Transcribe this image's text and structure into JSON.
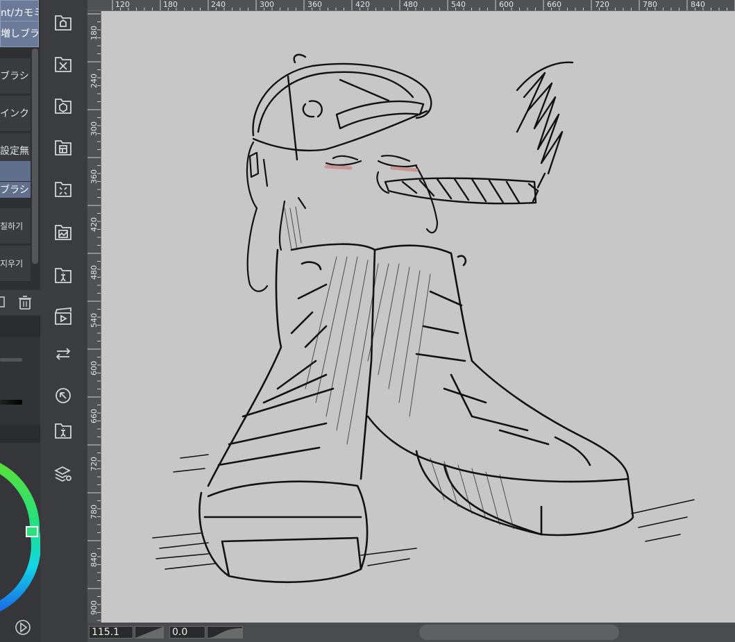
{
  "brush_panel": {
    "tabs": [
      {
        "label": "nt/カモミ"
      },
      {
        "label": "増しブラ"
      }
    ],
    "items": [
      {
        "label": "ブラシ",
        "selected": false
      },
      {
        "label": "インク",
        "selected": false
      },
      {
        "label": "設定無",
        "selected": false
      },
      {
        "label": "",
        "selected": true
      },
      {
        "label": "ブラシ",
        "selected": true
      },
      {
        "label": "칠하기",
        "selected": false
      },
      {
        "label": "지우기",
        "selected": false
      }
    ],
    "toolbar_icons": [
      "duplicate-icon",
      "trash-icon"
    ],
    "bottom_icons": [
      "play-icon"
    ]
  },
  "icon_strip": {
    "icons": [
      "home-material-icon",
      "tools-material-icon",
      "3d-material-icon",
      "layout-material-icon",
      "effect-material-icon",
      "image-material-icon",
      "figure-material-icon",
      "animation-icon",
      "swap-icon",
      "navigator-icon",
      "pose-material-icon",
      "layer-materials-icon"
    ]
  },
  "ruler_top": {
    "labels": [
      "120",
      "180",
      "240",
      "300",
      "360",
      "420",
      "480",
      "540",
      "600",
      "660",
      "720",
      "780",
      "840"
    ]
  },
  "ruler_left": {
    "labels": [
      "180",
      "240",
      "300",
      "360",
      "420",
      "480",
      "540",
      "600",
      "660",
      "720",
      "780",
      "840",
      "900"
    ]
  },
  "status_bar": {
    "zoom_value": "115.1",
    "rotation_value": "0.0"
  },
  "colors": {
    "canvas": "#c7c7c7",
    "selected_brush": "#5f6f8c",
    "color_wheel_handle": "#2ee07a"
  }
}
